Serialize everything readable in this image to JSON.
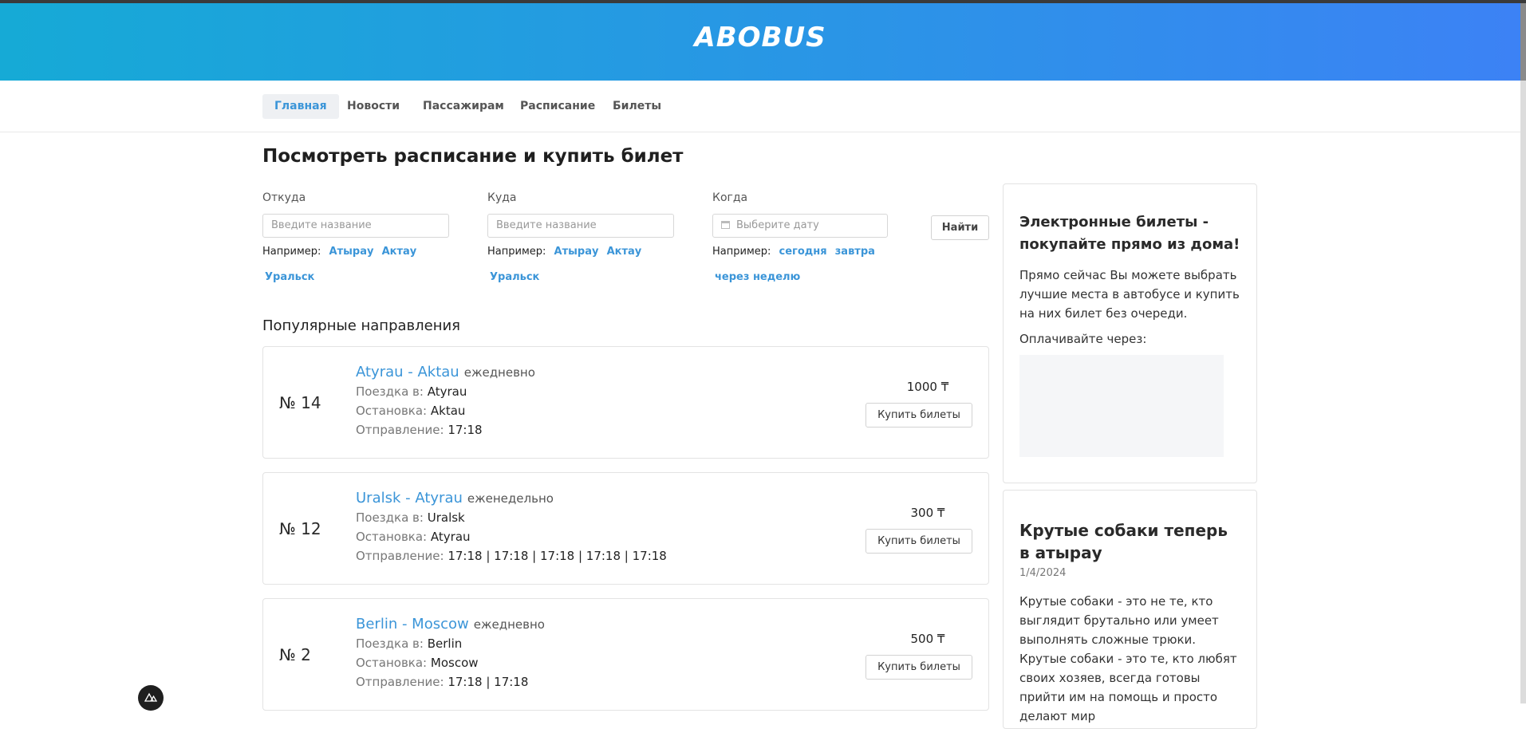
{
  "header": {
    "logo": "ABOBUS"
  },
  "nav": {
    "items": [
      {
        "label": "Главная",
        "active": true
      },
      {
        "label": "Новости",
        "active": false
      },
      {
        "label": "Пассажирам",
        "active": false
      },
      {
        "label": "Расписание",
        "active": false
      },
      {
        "label": "Билеты",
        "active": false
      }
    ]
  },
  "search": {
    "title": "Посмотреть расписание и купить билет",
    "from": {
      "label": "Откуда",
      "placeholder": "Введите название",
      "example_prefix": "Например:",
      "examples": [
        "Атырау",
        "Актау",
        "Уральск"
      ]
    },
    "to": {
      "label": "Куда",
      "placeholder": "Введите название",
      "example_prefix": "Например:",
      "examples": [
        "Атырау",
        "Актау",
        "Уральск"
      ]
    },
    "when": {
      "label": "Когда",
      "placeholder": "Выберите дату",
      "example_prefix": "Например:",
      "examples": [
        "сегодня",
        "завтра",
        "через неделю"
      ]
    },
    "find_label": "Найти"
  },
  "popular": {
    "title": "Популярные направления",
    "labels": {
      "trip_to": "Поездка в:",
      "stop": "Остановка:",
      "departure": "Отправление:"
    },
    "buy_label": "Купить билеты",
    "routes": [
      {
        "number": "№ 14",
        "title": "Atyrau - Aktau",
        "frequency": "ежедневно",
        "trip_to": "Atyrau",
        "stop": "Aktau",
        "departure": "17:18",
        "price": "1000 ₸"
      },
      {
        "number": "№ 12",
        "title": "Uralsk - Atyrau",
        "frequency": "еженедельно",
        "trip_to": "Uralsk",
        "stop": "Atyrau",
        "departure": "17:18 | 17:18 | 17:18 | 17:18 | 17:18",
        "price": "300 ₸"
      },
      {
        "number": "№ 2",
        "title": "Berlin - Moscow",
        "frequency": "ежедневно",
        "trip_to": "Berlin",
        "stop": "Moscow",
        "departure": "17:18 | 17:18",
        "price": "500 ₸"
      }
    ]
  },
  "sidebar": {
    "promo": {
      "title": "Электронные билеты - покупайте прямо из дома!",
      "text": "Прямо сейчас Вы можете выбрать лучшие места в автобусе и купить на них билет без очереди.",
      "pay_label": "Оплачивайте через:"
    },
    "news": {
      "title": "Крутые собаки теперь в атырау",
      "date": "1/4/2024",
      "text": "Крутые собаки - это не те, кто выглядит брутально или умеет выполнять сложные трюки. Крутые собаки - это те, кто любят своих хозяев, всегда готовы прийти им на помощь и просто делают мир"
    }
  },
  "colors": {
    "accent": "#3b95d8",
    "header_start": "#16aad6",
    "header_end": "#3c82f5"
  },
  "icons": {
    "calendar": "calendar-icon",
    "devtools": "nuxt-devtools-icon"
  }
}
